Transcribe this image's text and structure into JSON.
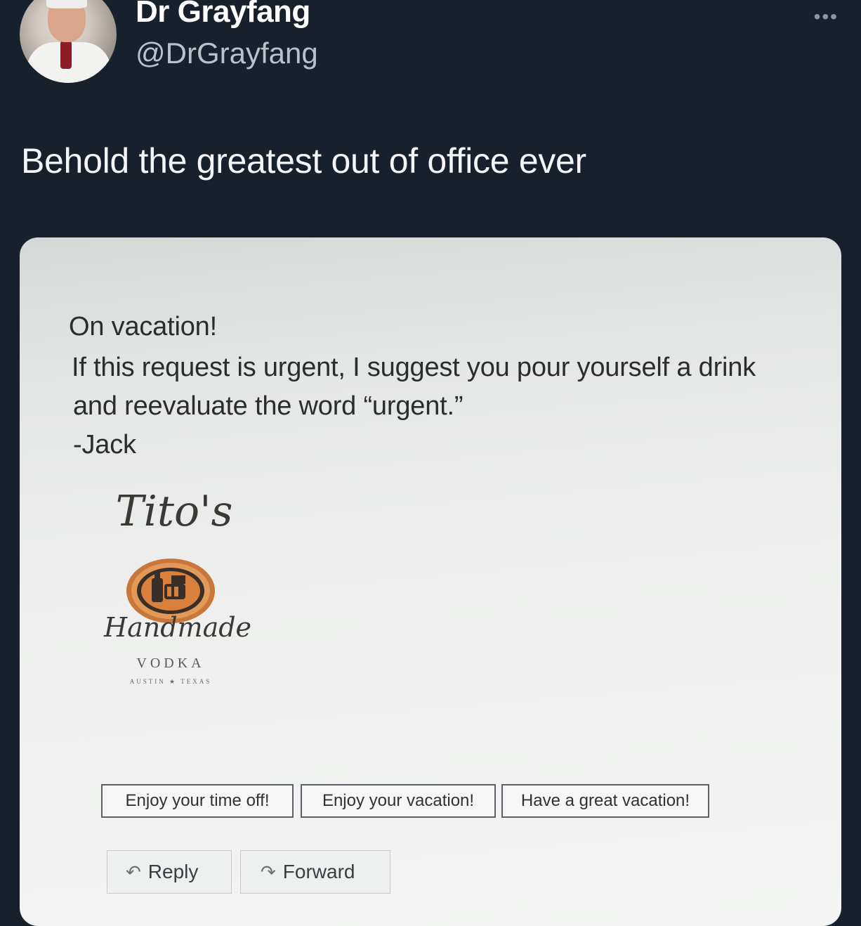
{
  "post": {
    "display_name": "Dr Grayfang",
    "handle": "@DrGrayfang",
    "more_icon": "•••",
    "text": "Behold the greatest out of office ever"
  },
  "email": {
    "lines": [
      "On vacation!",
      "If this request is urgent, I suggest you pour yourself a drink",
      "and reevaluate the word “urgent.”",
      "-Jack"
    ],
    "logo": {
      "brand": "Tito's",
      "tagline": "Handmade",
      "product": "VODKA",
      "location": "AUSTIN ★ TEXAS"
    },
    "quick_replies": [
      "Enjoy your time off!",
      "Enjoy your vacation!",
      "Have a great vacation!"
    ],
    "actions": {
      "reply_icon": "↶",
      "reply": "Reply",
      "forward_icon": "↷",
      "forward": "Forward"
    }
  }
}
